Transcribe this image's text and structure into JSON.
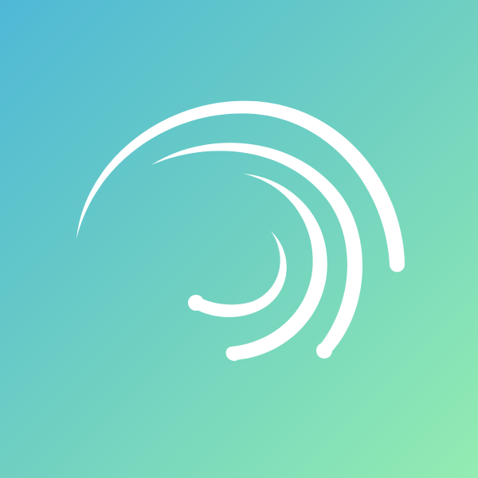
{
  "app_icon": {
    "icon": "alight-motion-swirl-icon",
    "colors": {
      "gradient_start": "#4fb8d6",
      "gradient_mid": "#6fd0c2",
      "gradient_end": "#93ecb1",
      "mark": "#ffffff"
    }
  }
}
